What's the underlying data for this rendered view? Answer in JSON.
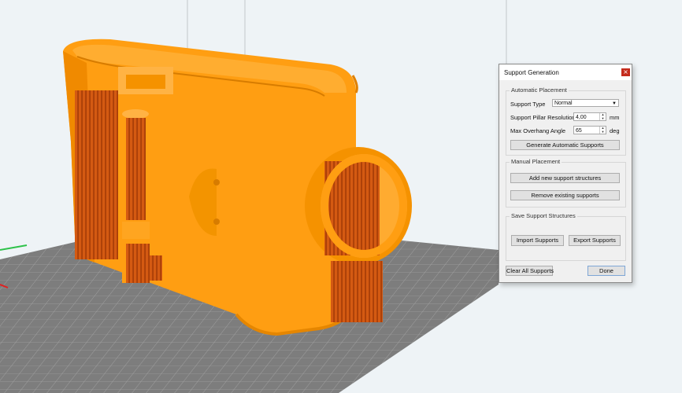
{
  "dialog": {
    "title": "Support Generation",
    "close_icon": "close-icon",
    "automatic": {
      "group_label": "Automatic Placement",
      "support_type_label": "Support Type",
      "support_type_value": "Normal",
      "pillar_resolution_label": "Support Pillar Resolution",
      "pillar_resolution_value": "4,00",
      "pillar_resolution_unit": "mm",
      "overhang_angle_label": "Max Overhang Angle",
      "overhang_angle_value": "65",
      "overhang_angle_unit": "deg",
      "generate_button": "Generate Automatic Supports"
    },
    "manual": {
      "group_label": "Manual Placement",
      "add_button": "Add new support structures",
      "remove_button": "Remove existing supports"
    },
    "save": {
      "group_label": "Save Support Structures",
      "import_button": "Import Supports",
      "export_button": "Export Supports"
    },
    "clear_button": "Clear All Supports",
    "done_button": "Done"
  },
  "colors": {
    "model": "#ff9e12",
    "model_shade": "#f08a00",
    "support": "#d45a12",
    "build_plate": "#7d7d7d",
    "background": "#eef3f6"
  }
}
